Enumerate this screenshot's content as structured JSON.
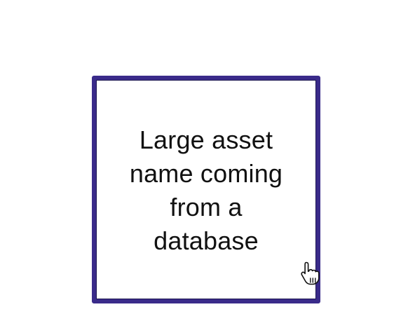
{
  "card": {
    "name_lines": [
      "Large asset",
      "name coming",
      "from a",
      "database"
    ],
    "border_color": "#3a2b8a"
  },
  "cursor": {
    "icon": "hand-pointer-icon"
  }
}
